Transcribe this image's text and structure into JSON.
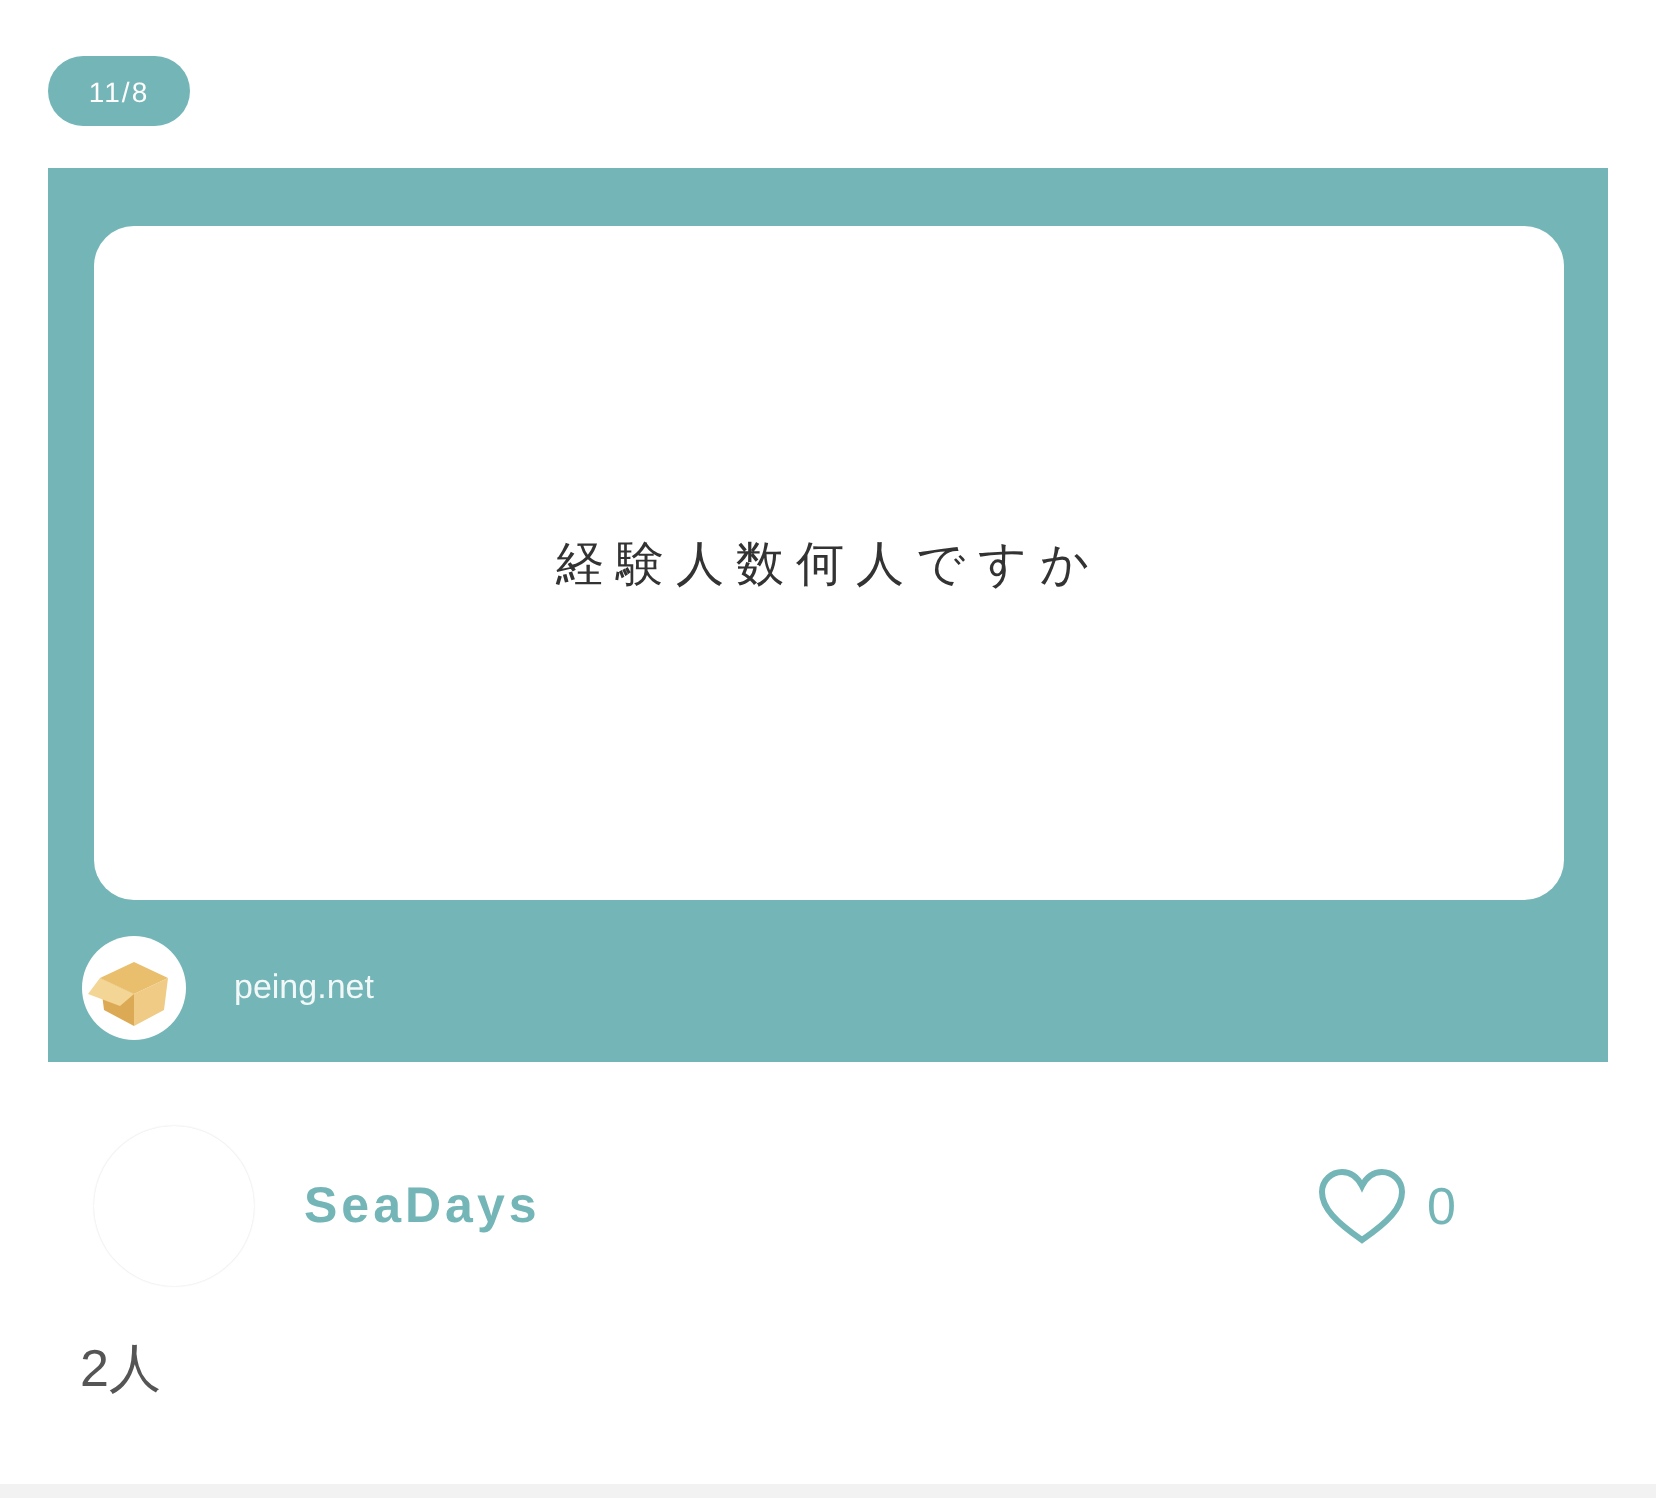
{
  "date_badge": "11/8",
  "question_card": {
    "question": "経験人数何人ですか",
    "site": "peing.net"
  },
  "answerer": {
    "name": "SeaDays",
    "likes": "0",
    "liked": false
  },
  "answer": "2人"
}
